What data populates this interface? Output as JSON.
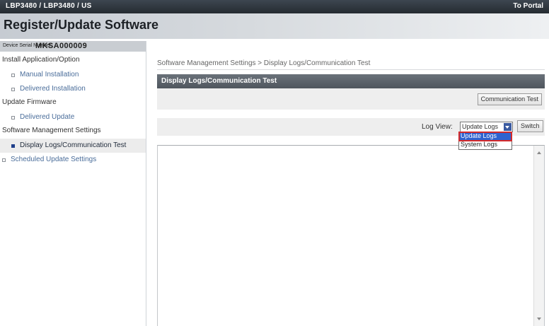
{
  "header": {
    "model": "LBP3480 / LBP3480 / US",
    "portal_link": "To Portal",
    "page_title": "Register/Update Software"
  },
  "device": {
    "serial_label": "Device Serial Number:",
    "serial_value": "MKSA000009"
  },
  "sidebar": {
    "install_section": "Install Application/Option",
    "manual_installation": "Manual Installation",
    "delivered_installation": "Delivered Installation",
    "update_section": "Update Firmware",
    "delivered_update": "Delivered Update",
    "software_section": "Software Management Settings",
    "display_logs": "Display Logs/Communication Test",
    "scheduled_update": "Scheduled Update Settings"
  },
  "main": {
    "breadcrumb": "Software Management Settings > Display Logs/Communication Test",
    "panel_title": "Display Logs/Communication Test",
    "communication_test_button": "Communication Test",
    "log_view_label": "Log View:",
    "log_view_selected": "Update Logs",
    "switch_button": "Switch",
    "log_view_options": [
      "Update Logs",
      "System Logs"
    ]
  },
  "colors": {
    "top_bar": "#2e353c",
    "panel_header": "#5a6169",
    "link": "#4a6d9a",
    "dropdown_highlight": "#2f63d0",
    "annotation_red": "#d42a2a"
  }
}
